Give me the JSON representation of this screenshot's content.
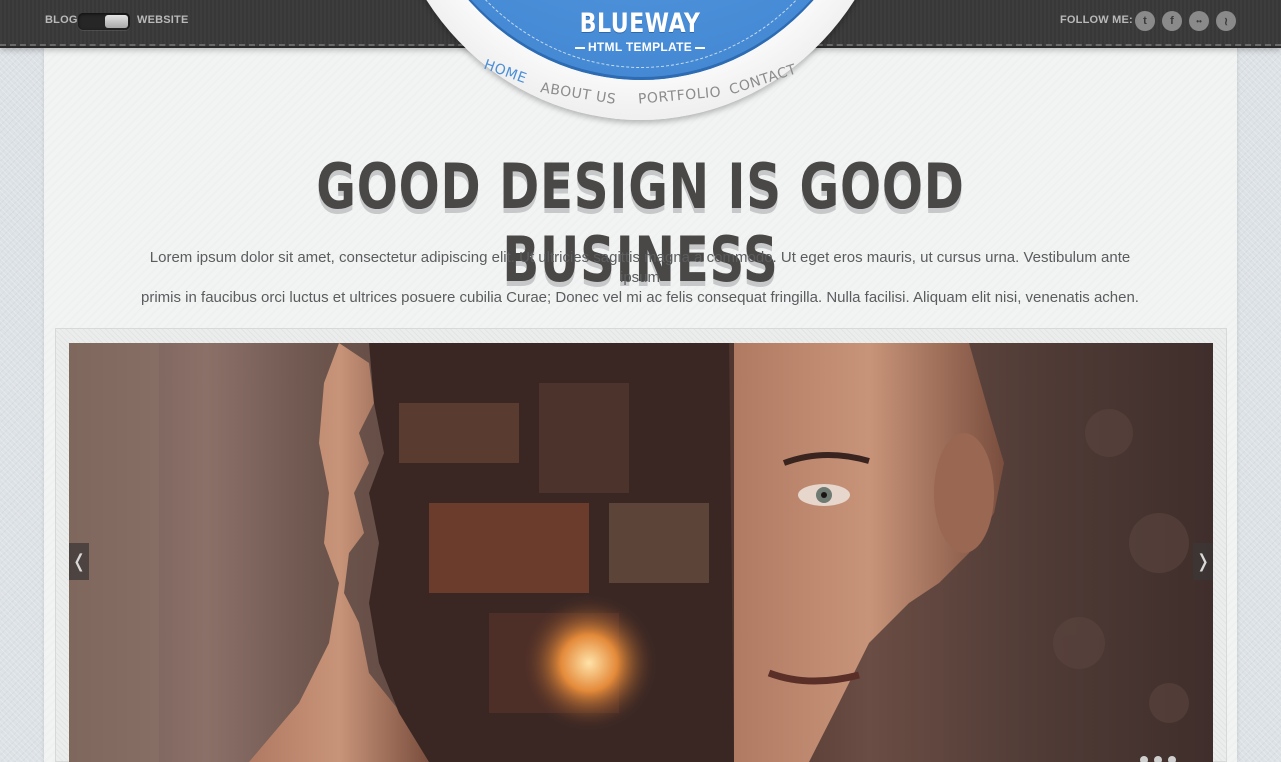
{
  "topbar": {
    "blog_label": "BLOG",
    "website_label": "WEBSITE",
    "follow_label": "FOLLOW ME:",
    "social": [
      {
        "icon": "twitter-icon",
        "glyph": "t"
      },
      {
        "icon": "facebook-icon",
        "glyph": "f"
      },
      {
        "icon": "flickr-icon",
        "glyph": "••"
      },
      {
        "icon": "rss-icon",
        "glyph": "≀"
      }
    ]
  },
  "logo": {
    "title": "BLUEWAY",
    "subtitle": "HTML TEMPLATE"
  },
  "nav": {
    "items": [
      {
        "label": "HOME",
        "active": true
      },
      {
        "label": "ABOUT US",
        "active": false
      },
      {
        "label": "PORTFOLIO",
        "active": false
      },
      {
        "label": "CONTACT",
        "active": false
      }
    ]
  },
  "hero": {
    "headline": "GOOD DESIGN IS GOOD BUSINESS",
    "intro_line1": "Lorem ipsum dolor sit amet, consectetur adipiscing elit. Ut ultricies sagittis magna a commodo. Ut eget eros mauris, ut cursus urna. Vestibulum ante ipsum",
    "intro_line2": "primis in faucibus orci luctus et ultrices posuere cubilia Curae; Donec vel mi ac felis consequat fringilla. Nulla facilisi. Aliquam elit nisi, venenatis achen."
  },
  "slider": {
    "prev_glyph": "❬",
    "next_glyph": "❭"
  },
  "colors": {
    "accent_blue": "#4a8fd8",
    "topbar_dark": "#3b3b3b",
    "headline": "#4a4846"
  }
}
